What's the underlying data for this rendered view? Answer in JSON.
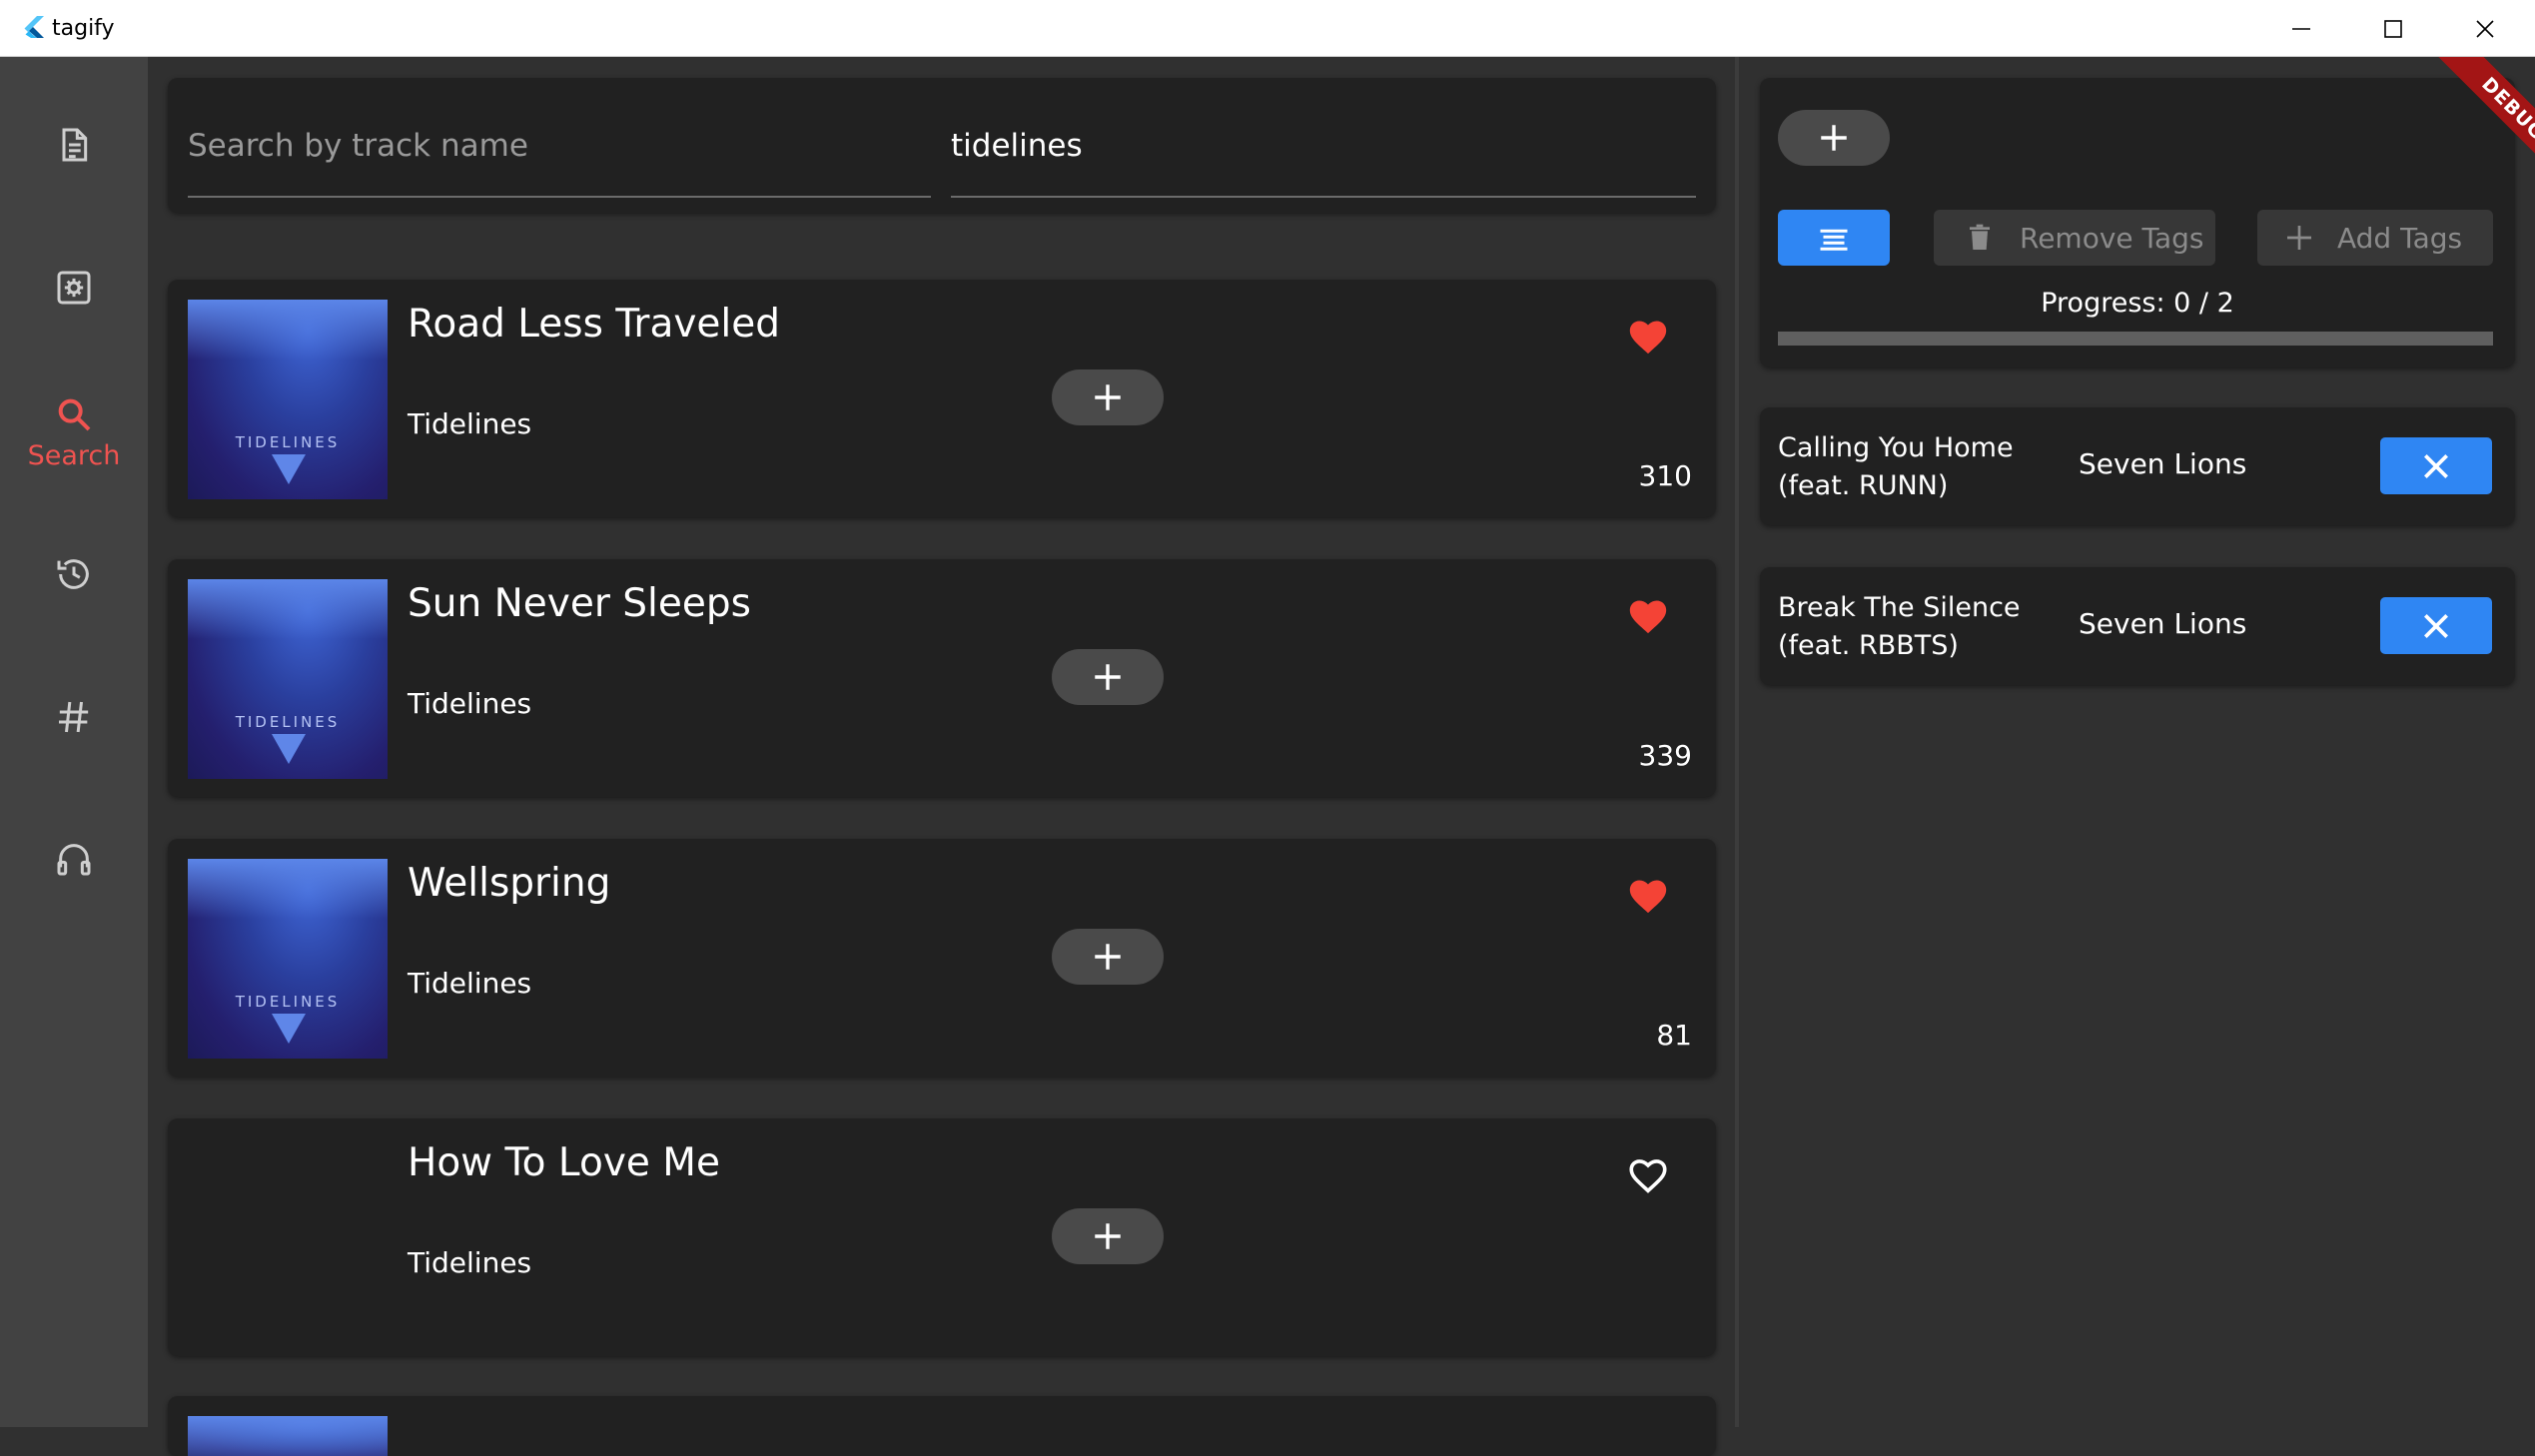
{
  "window": {
    "title": "tagify"
  },
  "nav": {
    "items": [
      {
        "icon": "description-icon",
        "label": ""
      },
      {
        "icon": "settings-icon",
        "label": ""
      },
      {
        "icon": "search-icon",
        "label": "Search",
        "active": true
      },
      {
        "icon": "history-icon",
        "label": ""
      },
      {
        "icon": "tag-icon",
        "label": ""
      },
      {
        "icon": "headphones-icon",
        "label": ""
      }
    ],
    "active_color": "#ef5350"
  },
  "search": {
    "track_placeholder": "Search by track name",
    "track_value": "",
    "artist_value": "tidelines"
  },
  "tracks": [
    {
      "title": "Road Less Traveled",
      "artist": "Tidelines",
      "count": "310",
      "liked": true,
      "cover_text": "TIDELINES"
    },
    {
      "title": "Sun Never Sleeps",
      "artist": "Tidelines",
      "count": "339",
      "liked": true,
      "cover_text": "TIDELINES"
    },
    {
      "title": "Wellspring",
      "artist": "Tidelines",
      "count": "81",
      "liked": true,
      "cover_text": "TIDELINES"
    },
    {
      "title": "How To Love Me",
      "artist": "Tidelines",
      "count": "",
      "liked": false
    }
  ],
  "tagger": {
    "remove_label": "Remove Tags",
    "add_label": "Add Tags",
    "progress_text": "Progress: 0 / 2",
    "progress": 0,
    "accent": "#2f86f3",
    "queue": [
      {
        "title": "Calling You Home (feat. RUNN)",
        "artist": "Seven Lions"
      },
      {
        "title": "Break The Silence (feat. RBBTS)",
        "artist": "Seven Lions"
      }
    ]
  },
  "debug_banner": "DEBUG"
}
